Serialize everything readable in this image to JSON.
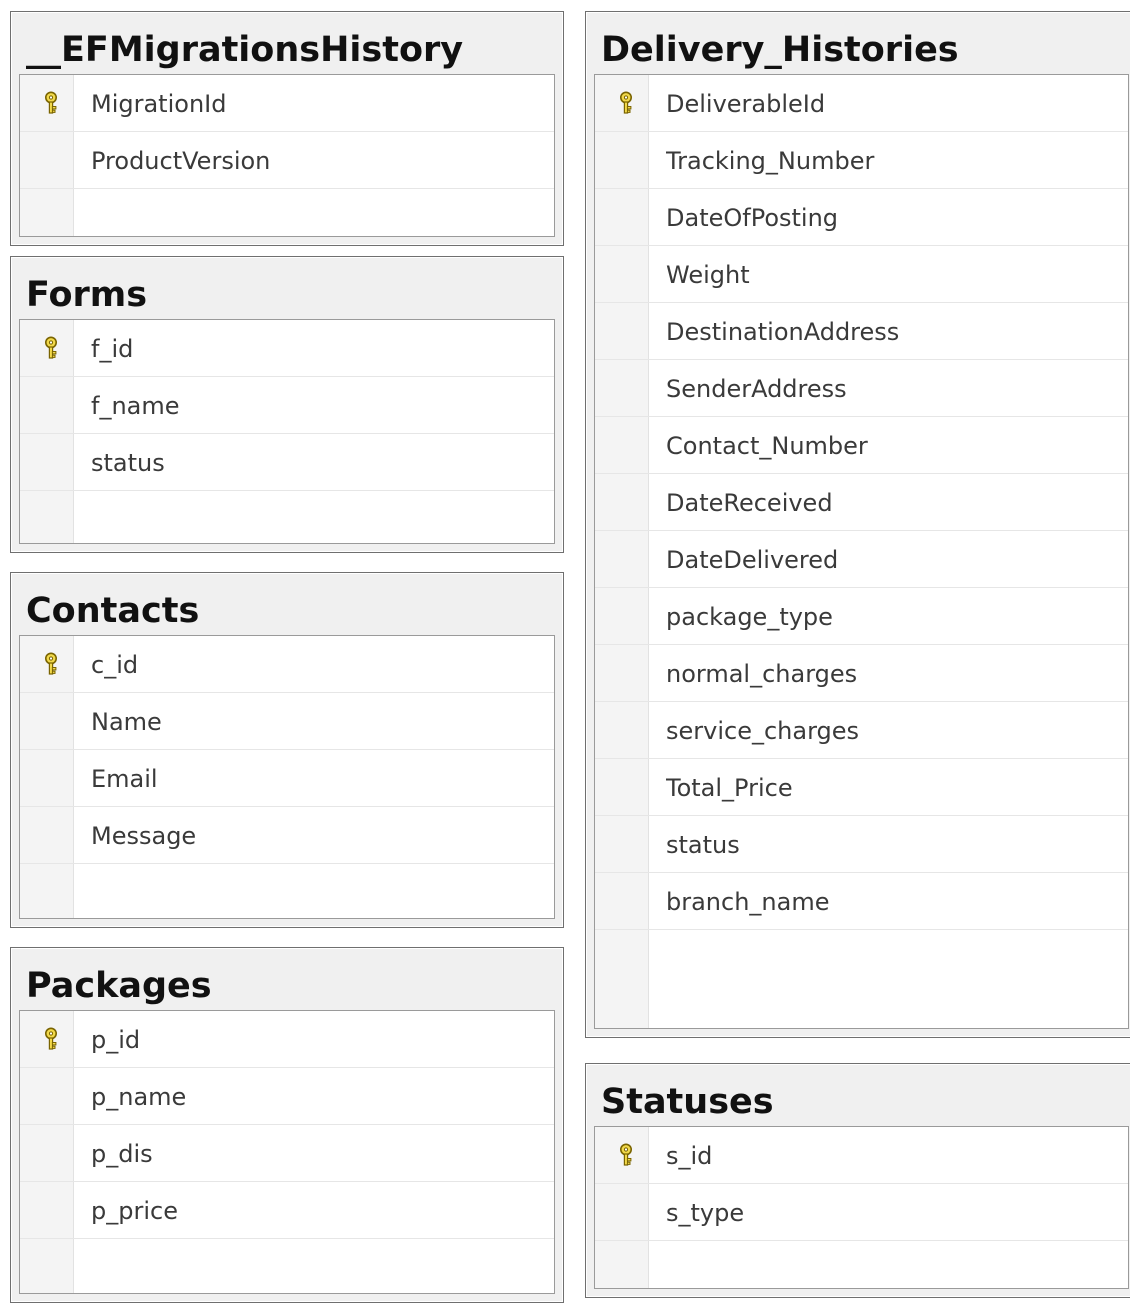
{
  "tables": {
    "migrations": {
      "title": "__EFMigrationsHistory",
      "columns": [
        {
          "name": "MigrationId",
          "primary_key": true
        },
        {
          "name": "ProductVersion",
          "primary_key": false
        }
      ]
    },
    "forms": {
      "title": "Forms",
      "columns": [
        {
          "name": "f_id",
          "primary_key": true
        },
        {
          "name": "f_name",
          "primary_key": false
        },
        {
          "name": "status",
          "primary_key": false
        }
      ]
    },
    "contacts": {
      "title": "Contacts",
      "columns": [
        {
          "name": "c_id",
          "primary_key": true
        },
        {
          "name": "Name",
          "primary_key": false
        },
        {
          "name": "Email",
          "primary_key": false
        },
        {
          "name": "Message",
          "primary_key": false
        }
      ]
    },
    "packages": {
      "title": "Packages",
      "columns": [
        {
          "name": "p_id",
          "primary_key": true
        },
        {
          "name": "p_name",
          "primary_key": false
        },
        {
          "name": "p_dis",
          "primary_key": false
        },
        {
          "name": "p_price",
          "primary_key": false
        }
      ]
    },
    "delivery": {
      "title": "Delivery_Histories",
      "columns": [
        {
          "name": "DeliverableId",
          "primary_key": true
        },
        {
          "name": "Tracking_Number",
          "primary_key": false
        },
        {
          "name": "DateOfPosting",
          "primary_key": false
        },
        {
          "name": "Weight",
          "primary_key": false
        },
        {
          "name": "DestinationAddress",
          "primary_key": false
        },
        {
          "name": "SenderAddress",
          "primary_key": false
        },
        {
          "name": "Contact_Number",
          "primary_key": false
        },
        {
          "name": "DateReceived",
          "primary_key": false
        },
        {
          "name": "DateDelivered",
          "primary_key": false
        },
        {
          "name": "package_type",
          "primary_key": false
        },
        {
          "name": "normal_charges",
          "primary_key": false
        },
        {
          "name": "service_charges",
          "primary_key": false
        },
        {
          "name": "Total_Price",
          "primary_key": false
        },
        {
          "name": "status",
          "primary_key": false
        },
        {
          "name": "branch_name",
          "primary_key": false
        }
      ]
    },
    "statuses": {
      "title": "Statuses",
      "columns": [
        {
          "name": "s_id",
          "primary_key": true
        },
        {
          "name": "s_type",
          "primary_key": false
        }
      ]
    }
  },
  "icons": {
    "primary_key": "key-icon"
  },
  "colors": {
    "key_fill": "#f2d94a",
    "key_stroke": "#7a6400"
  }
}
